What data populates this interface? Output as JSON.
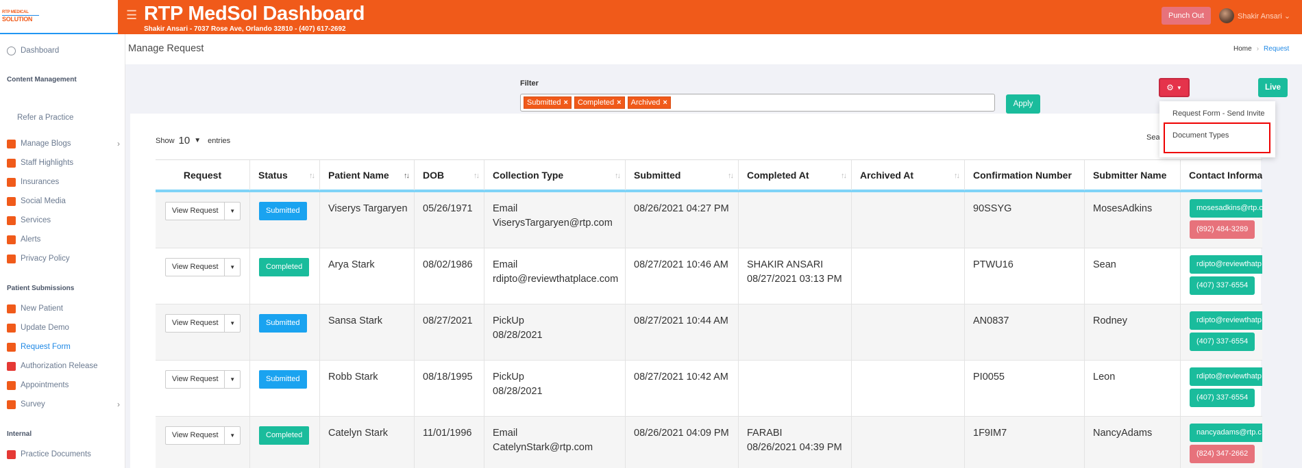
{
  "app": {
    "logo_line1": "RTP MEDICAL",
    "logo_line2": "SOLUTION",
    "title": "RTP MedSol Dashboard",
    "subtitle": "Shakir Ansari - 7037 Rose Ave, Orlando 32810 - (407) 617-2692",
    "punch_out": "Punch Out",
    "user_name": "Shakir Ansari"
  },
  "sidebar": {
    "items": [
      {
        "label": "Dashboard"
      },
      {
        "section": "Content Management"
      },
      {
        "label": "Refer a Practice"
      },
      {
        "label": "Manage Blogs"
      },
      {
        "label": "Staff Highlights"
      },
      {
        "label": "Insurances"
      },
      {
        "label": "Social Media"
      },
      {
        "label": "Services"
      },
      {
        "label": "Alerts"
      },
      {
        "label": "Privacy Policy"
      },
      {
        "section": "Patient Submissions"
      },
      {
        "label": "New Patient"
      },
      {
        "label": "Update Demo"
      },
      {
        "label": "Request Form"
      },
      {
        "label": "Authorization Release"
      },
      {
        "label": "Appointments"
      },
      {
        "label": "Survey"
      },
      {
        "section": "Internal"
      },
      {
        "label": "Practice Documents"
      }
    ],
    "accent": "#1e88e5"
  },
  "page": {
    "title": "Manage Request",
    "breadcrumb_home": "Home",
    "breadcrumb_current": "Request"
  },
  "filter": {
    "label": "Filter",
    "chips": [
      "Submitted",
      "Completed",
      "Archived"
    ],
    "apply": "Apply"
  },
  "toolbar": {
    "live": "Live",
    "dropdown": [
      "Request Form - Send Invite",
      "Document Types"
    ]
  },
  "table": {
    "show_label": "Show",
    "show_value": "10",
    "entries_label": "entries",
    "search_label": "Sea",
    "columns": [
      "Request",
      "Status",
      "Patient Name",
      "DOB",
      "Collection Type",
      "Submitted",
      "Completed At",
      "Archived At",
      "Confirmation Number",
      "Submitter Name",
      "Contact Informat"
    ],
    "view_request": "View Request",
    "rows": [
      {
        "status": "Submitted",
        "patient": "Viserys Targaryen",
        "dob": "05/26/1971",
        "ctype1": "Email",
        "ctype2": "ViserysTargaryen@rtp.com",
        "submitted": "08/26/2021 04:27 PM",
        "completed1": "",
        "completed2": "",
        "archived": "",
        "conf": "90SSYG",
        "submitter": "MosesAdkins",
        "email": "mosesadkins@rtp.c",
        "phone": "(892) 484-3289",
        "phone_color": "red"
      },
      {
        "status": "Completed",
        "patient": "Arya Stark",
        "dob": "08/02/1986",
        "ctype1": "Email",
        "ctype2": "rdipto@reviewthatplace.com",
        "submitted": "08/27/2021 10:46 AM",
        "completed1": "SHAKIR ANSARI",
        "completed2": "08/27/2021 03:13 PM",
        "archived": "",
        "conf": "PTWU16",
        "submitter": "Sean",
        "email": "rdipto@reviewthatp",
        "phone": "(407) 337-6554",
        "phone_color": "green"
      },
      {
        "status": "Submitted",
        "patient": "Sansa Stark",
        "dob": "08/27/2021",
        "ctype1": "PickUp",
        "ctype2": "08/28/2021",
        "submitted": "08/27/2021 10:44 AM",
        "completed1": "",
        "completed2": "",
        "archived": "",
        "conf": "AN0837",
        "submitter": "Rodney",
        "email": "rdipto@reviewthatp",
        "phone": "(407) 337-6554",
        "phone_color": "green"
      },
      {
        "status": "Submitted",
        "patient": "Robb Stark",
        "dob": "08/18/1995",
        "ctype1": "PickUp",
        "ctype2": "08/28/2021",
        "submitted": "08/27/2021 10:42 AM",
        "completed1": "",
        "completed2": "",
        "archived": "",
        "conf": "PI0055",
        "submitter": "Leon",
        "email": "rdipto@reviewthatp",
        "phone": "(407) 337-6554",
        "phone_color": "green"
      },
      {
        "status": "Completed",
        "patient": "Catelyn Stark",
        "dob": "11/01/1996",
        "ctype1": "Email",
        "ctype2": "CatelynStark@rtp.com",
        "submitted": "08/26/2021 04:09 PM",
        "completed1": "FARABI",
        "completed2": "08/26/2021 04:39 PM",
        "archived": "",
        "conf": "1F9IM7",
        "submitter": "NancyAdams",
        "email": "nancyadams@rtp.c",
        "phone": "(824) 347-2662",
        "phone_color": "red"
      }
    ]
  }
}
